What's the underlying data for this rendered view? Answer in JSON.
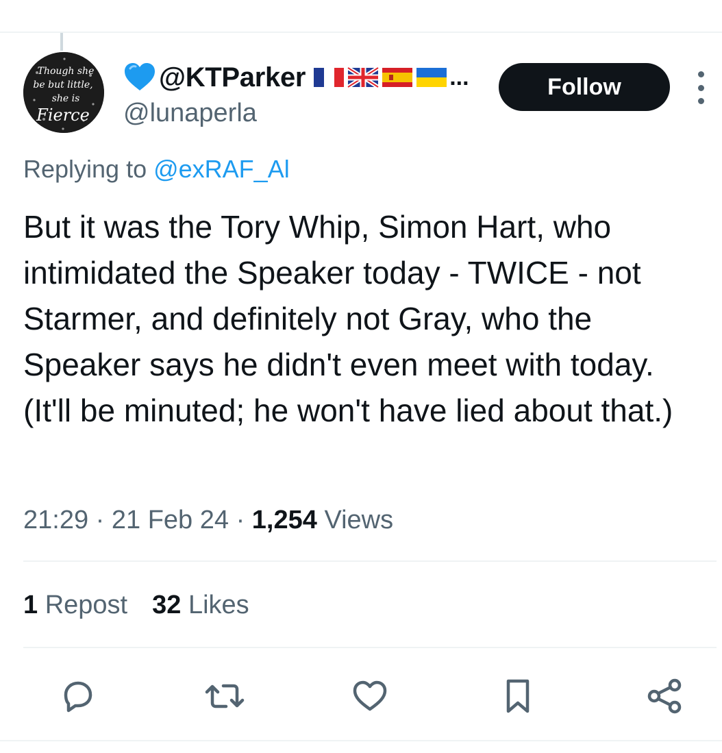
{
  "author": {
    "display_name": "@KTParker",
    "handle": "@lunaperla",
    "name_emoji": "blue-heart",
    "flags": [
      "france-flag",
      "uk-flag",
      "spain-flag",
      "ukraine-flag"
    ],
    "truncation": "...",
    "avatar_text": [
      "Though she",
      "be but little,",
      "she is",
      "Fierce"
    ]
  },
  "follow_label": "Follow",
  "reply": {
    "prefix": "Replying to ",
    "handle": "@exRAF_Al"
  },
  "tweet_text": "But it was the Tory Whip, Simon Hart, who intimidated the Speaker today - TWICE - not Starmer, and definitely not Gray, who the Speaker says he didn't even meet with today. (It'll be minuted; he won't have lied about that.)",
  "meta": {
    "time": "21:29",
    "sep1": " · ",
    "date": "21 Feb 24",
    "sep2": " · ",
    "views_count": "1,254",
    "views_label": " Views"
  },
  "stats": {
    "reposts_count": "1",
    "reposts_label": " Repost",
    "likes_count": "32",
    "likes_label": " Likes"
  },
  "actions": [
    "reply-icon",
    "repost-icon",
    "like-icon",
    "bookmark-icon",
    "share-icon"
  ],
  "colors": {
    "text": "#0f1419",
    "secondary": "#536471",
    "link": "#1d9bf0",
    "divider": "#eff3f4",
    "heart": "#1d9bf0"
  }
}
